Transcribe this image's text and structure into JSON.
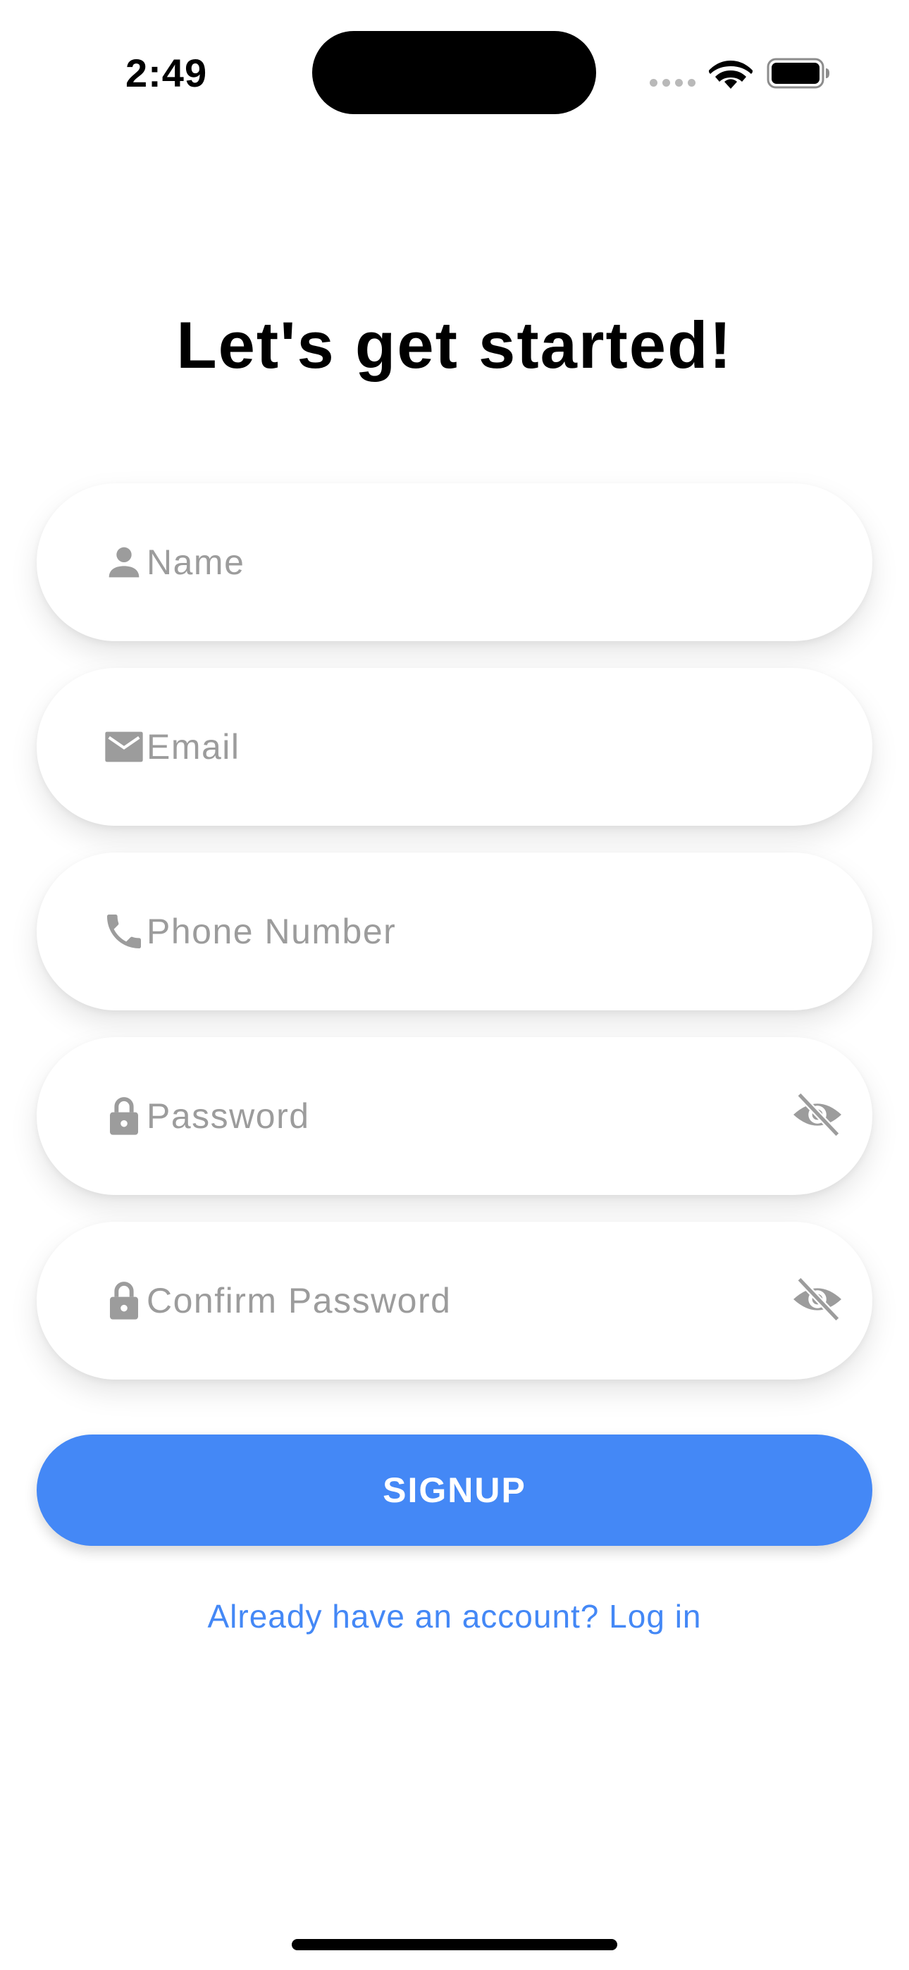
{
  "status_bar": {
    "time": "2:49"
  },
  "title": "Let's get started!",
  "fields": {
    "name": {
      "placeholder": "Name",
      "icon": "person-icon"
    },
    "email": {
      "placeholder": "Email",
      "icon": "mail-icon"
    },
    "phone": {
      "placeholder": "Phone Number",
      "icon": "phone-icon"
    },
    "password": {
      "placeholder": "Password",
      "icon": "lock-icon",
      "trailing_icon": "eye-off-icon"
    },
    "confirm_password": {
      "placeholder": "Confirm Password",
      "icon": "lock-icon",
      "trailing_icon": "eye-off-icon"
    }
  },
  "signup_button": {
    "label": "SIGNUP"
  },
  "login_link": "Already have an account? Log in",
  "colors": {
    "accent": "#4488f6",
    "icon_gray": "#9c9c9c",
    "placeholder_gray": "#9c9c9c",
    "background": "#ffffff"
  }
}
